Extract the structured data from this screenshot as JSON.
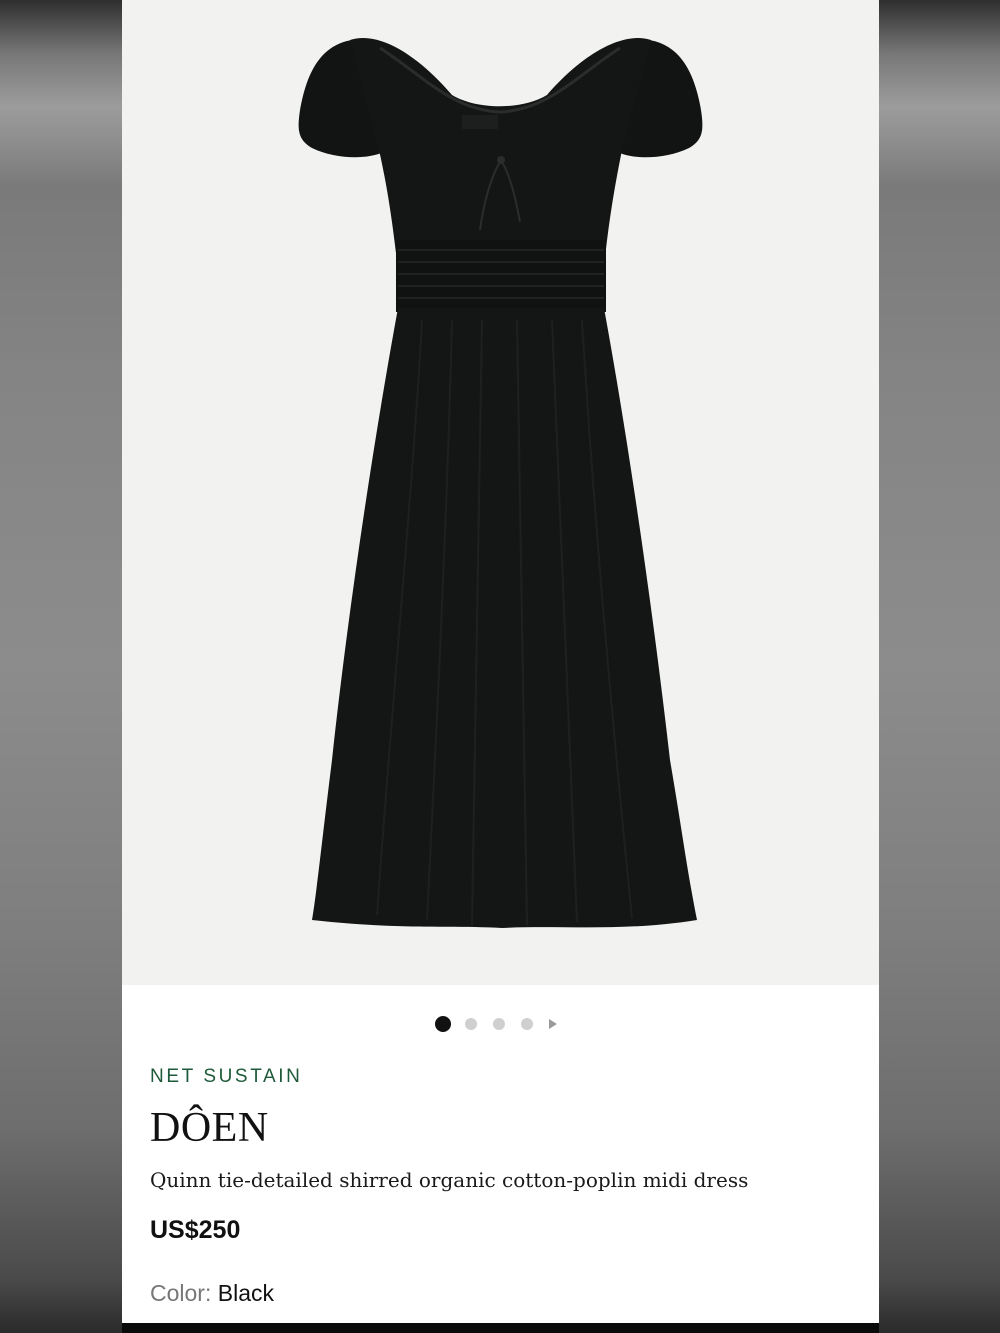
{
  "carousel": {
    "image_alt": "Black shirred midi dress product photo",
    "total_slides": 4,
    "active_slide": 1
  },
  "product": {
    "eyebrow": "NET SUSTAIN",
    "brand": "DÔEN",
    "title": "Quinn tie-detailed shirred organic cotton-poplin midi dress",
    "price": "US$250",
    "color_label": "Color:",
    "color_value": "Black"
  },
  "colors": {
    "eyebrow": "#1e5a3a",
    "dress": "#121414",
    "photo_bg": "#f2f2f0"
  },
  "icons": {
    "next": "play-arrow-icon"
  }
}
